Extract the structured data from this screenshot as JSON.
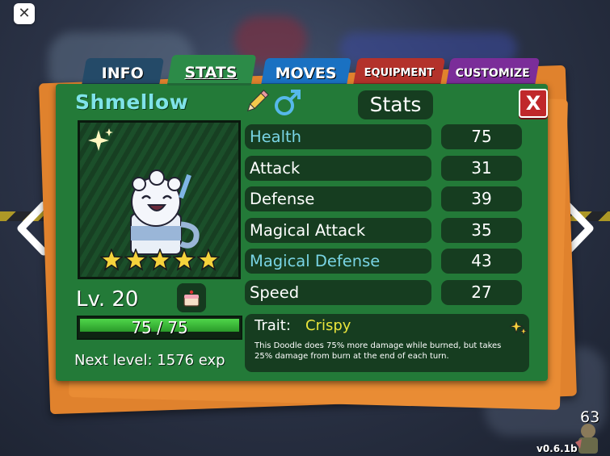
{
  "tabs": [
    {
      "label": "INFO"
    },
    {
      "label": "STATS"
    },
    {
      "label": "MOVES"
    },
    {
      "label": "EQUIPMENT"
    },
    {
      "label": "CUSTOMIZE"
    }
  ],
  "active_tab": "STATS",
  "doodle": {
    "name": "Shmellow",
    "gender_icon": "male-icon",
    "level_text": "Lv. 20",
    "hp_text": "75 / 75",
    "hp_fraction": 1.0,
    "star_count": 5,
    "next_level_text": "Next level: 1576 exp"
  },
  "stats_panel": {
    "title": "Stats",
    "close_label": "X",
    "rows": [
      {
        "label": "Health",
        "value": "75",
        "highlight": true
      },
      {
        "label": "Attack",
        "value": "31",
        "highlight": false
      },
      {
        "label": "Defense",
        "value": "39",
        "highlight": false
      },
      {
        "label": "Magical Attack",
        "value": "35",
        "highlight": false
      },
      {
        "label": "Magical Defense",
        "value": "43",
        "highlight": true
      },
      {
        "label": "Speed",
        "value": "27",
        "highlight": false
      }
    ]
  },
  "trait": {
    "label": "Trait:",
    "name": "Crispy",
    "description": "This Doodle does 75% more damage while burned, but takes 25% damage from burn at the end of each turn."
  },
  "hud": {
    "close_symbol": "✕",
    "player_count": "63",
    "version": "v0.6.1b"
  },
  "colors": {
    "panel_green": "#237a38",
    "stat_highlight": "#79d4e4",
    "trait_name": "#e9e53c"
  }
}
